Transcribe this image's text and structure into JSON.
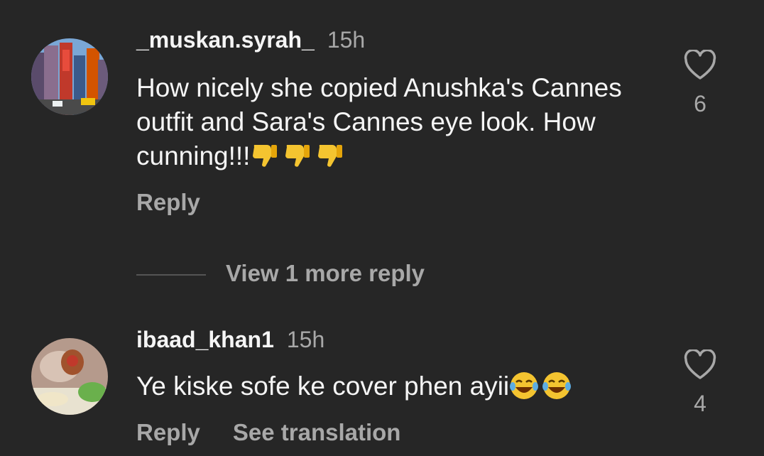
{
  "comments": [
    {
      "username": "_muskan.syrah_",
      "time": "15h",
      "text": "How nicely she copied Anushka's Cannes outfit and Sara's Cannes eye look. How cunning!!!",
      "emoji": "thumbs-down-icon",
      "emoji_count": 3,
      "likes": "6",
      "reply_label": "Reply"
    },
    {
      "username": "ibaad_khan1",
      "time": "15h",
      "text": "Ye kiske sofe ke cover phen ayii",
      "emoji": "laughing-tears-icon",
      "emoji_count": 2,
      "likes": "4",
      "reply_label": "Reply",
      "translation_label": "See translation"
    }
  ],
  "view_more_replies": "View 1 more reply",
  "colors": {
    "background": "#262626",
    "primary_text": "#f5f5f5",
    "secondary_text": "#a8a8a8"
  }
}
